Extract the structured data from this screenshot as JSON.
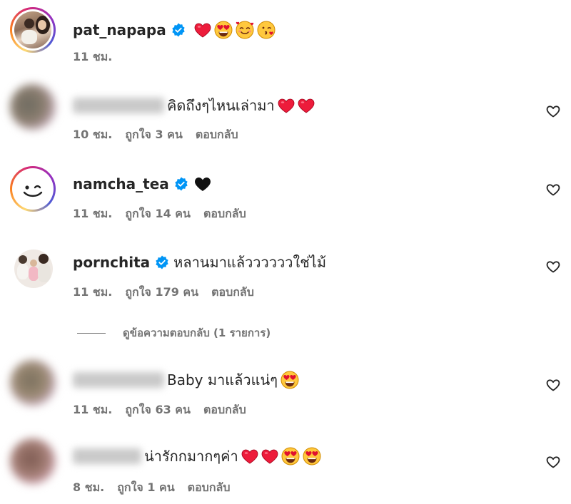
{
  "comments": [
    {
      "username": "pat_napapa",
      "verified": true,
      "text": "",
      "emojis": [
        "red-heart",
        "heart-eyes",
        "smiling-hearts",
        "kissing-face"
      ],
      "time": "11 ชม.",
      "likes": "",
      "reply": "",
      "avatar_icon": "profile-photo-mother-child"
    },
    {
      "username": "",
      "verified": false,
      "text": "คิดถึงๆไหนเล่ามา",
      "emojis": [
        "red-heart",
        "red-heart"
      ],
      "time": "10 ชม.",
      "likes": "ถูกใจ 3 คน",
      "reply": "ตอบกลับ",
      "avatar_icon": "blurred-avatar"
    },
    {
      "username": "namcha_tea",
      "verified": true,
      "text": "",
      "emojis": [
        "black-heart"
      ],
      "time": "11 ชม.",
      "likes": "ถูกใจ 14 คน",
      "reply": "ตอบกลับ",
      "avatar_icon": "smiley-face-avatar"
    },
    {
      "username": "pornchita",
      "verified": true,
      "text": "หลานมาแล้ววววววใช่ไม้",
      "emojis": [],
      "time": "11 ชม.",
      "likes": "ถูกใจ 179 คน",
      "reply": "ตอบกลับ",
      "avatar_icon": "family-photo-avatar"
    },
    {
      "username": "",
      "verified": false,
      "text": "Baby มาแล้วแน่ๆ",
      "emojis": [
        "heart-eyes"
      ],
      "time": "11 ชม.",
      "likes": "ถูกใจ 63 คน",
      "reply": "ตอบกลับ",
      "avatar_icon": "blurred-avatar"
    },
    {
      "username": "",
      "verified": false,
      "text": "น่ารักกมากๆค่า",
      "emojis": [
        "red-heart",
        "red-heart",
        "heart-eyes",
        "heart-eyes"
      ],
      "time": "8 ชม.",
      "likes": "ถูกใจ 1 คน",
      "reply": "ตอบกลับ",
      "avatar_icon": "blurred-avatar"
    }
  ],
  "view_replies": "ดูข้อความตอบกลับ (1 รายการ)",
  "colors": {
    "verified_blue": "#0095f6",
    "heart_red": "#ed1c3b",
    "meta_gray": "#737373",
    "text_dark": "#262626"
  }
}
